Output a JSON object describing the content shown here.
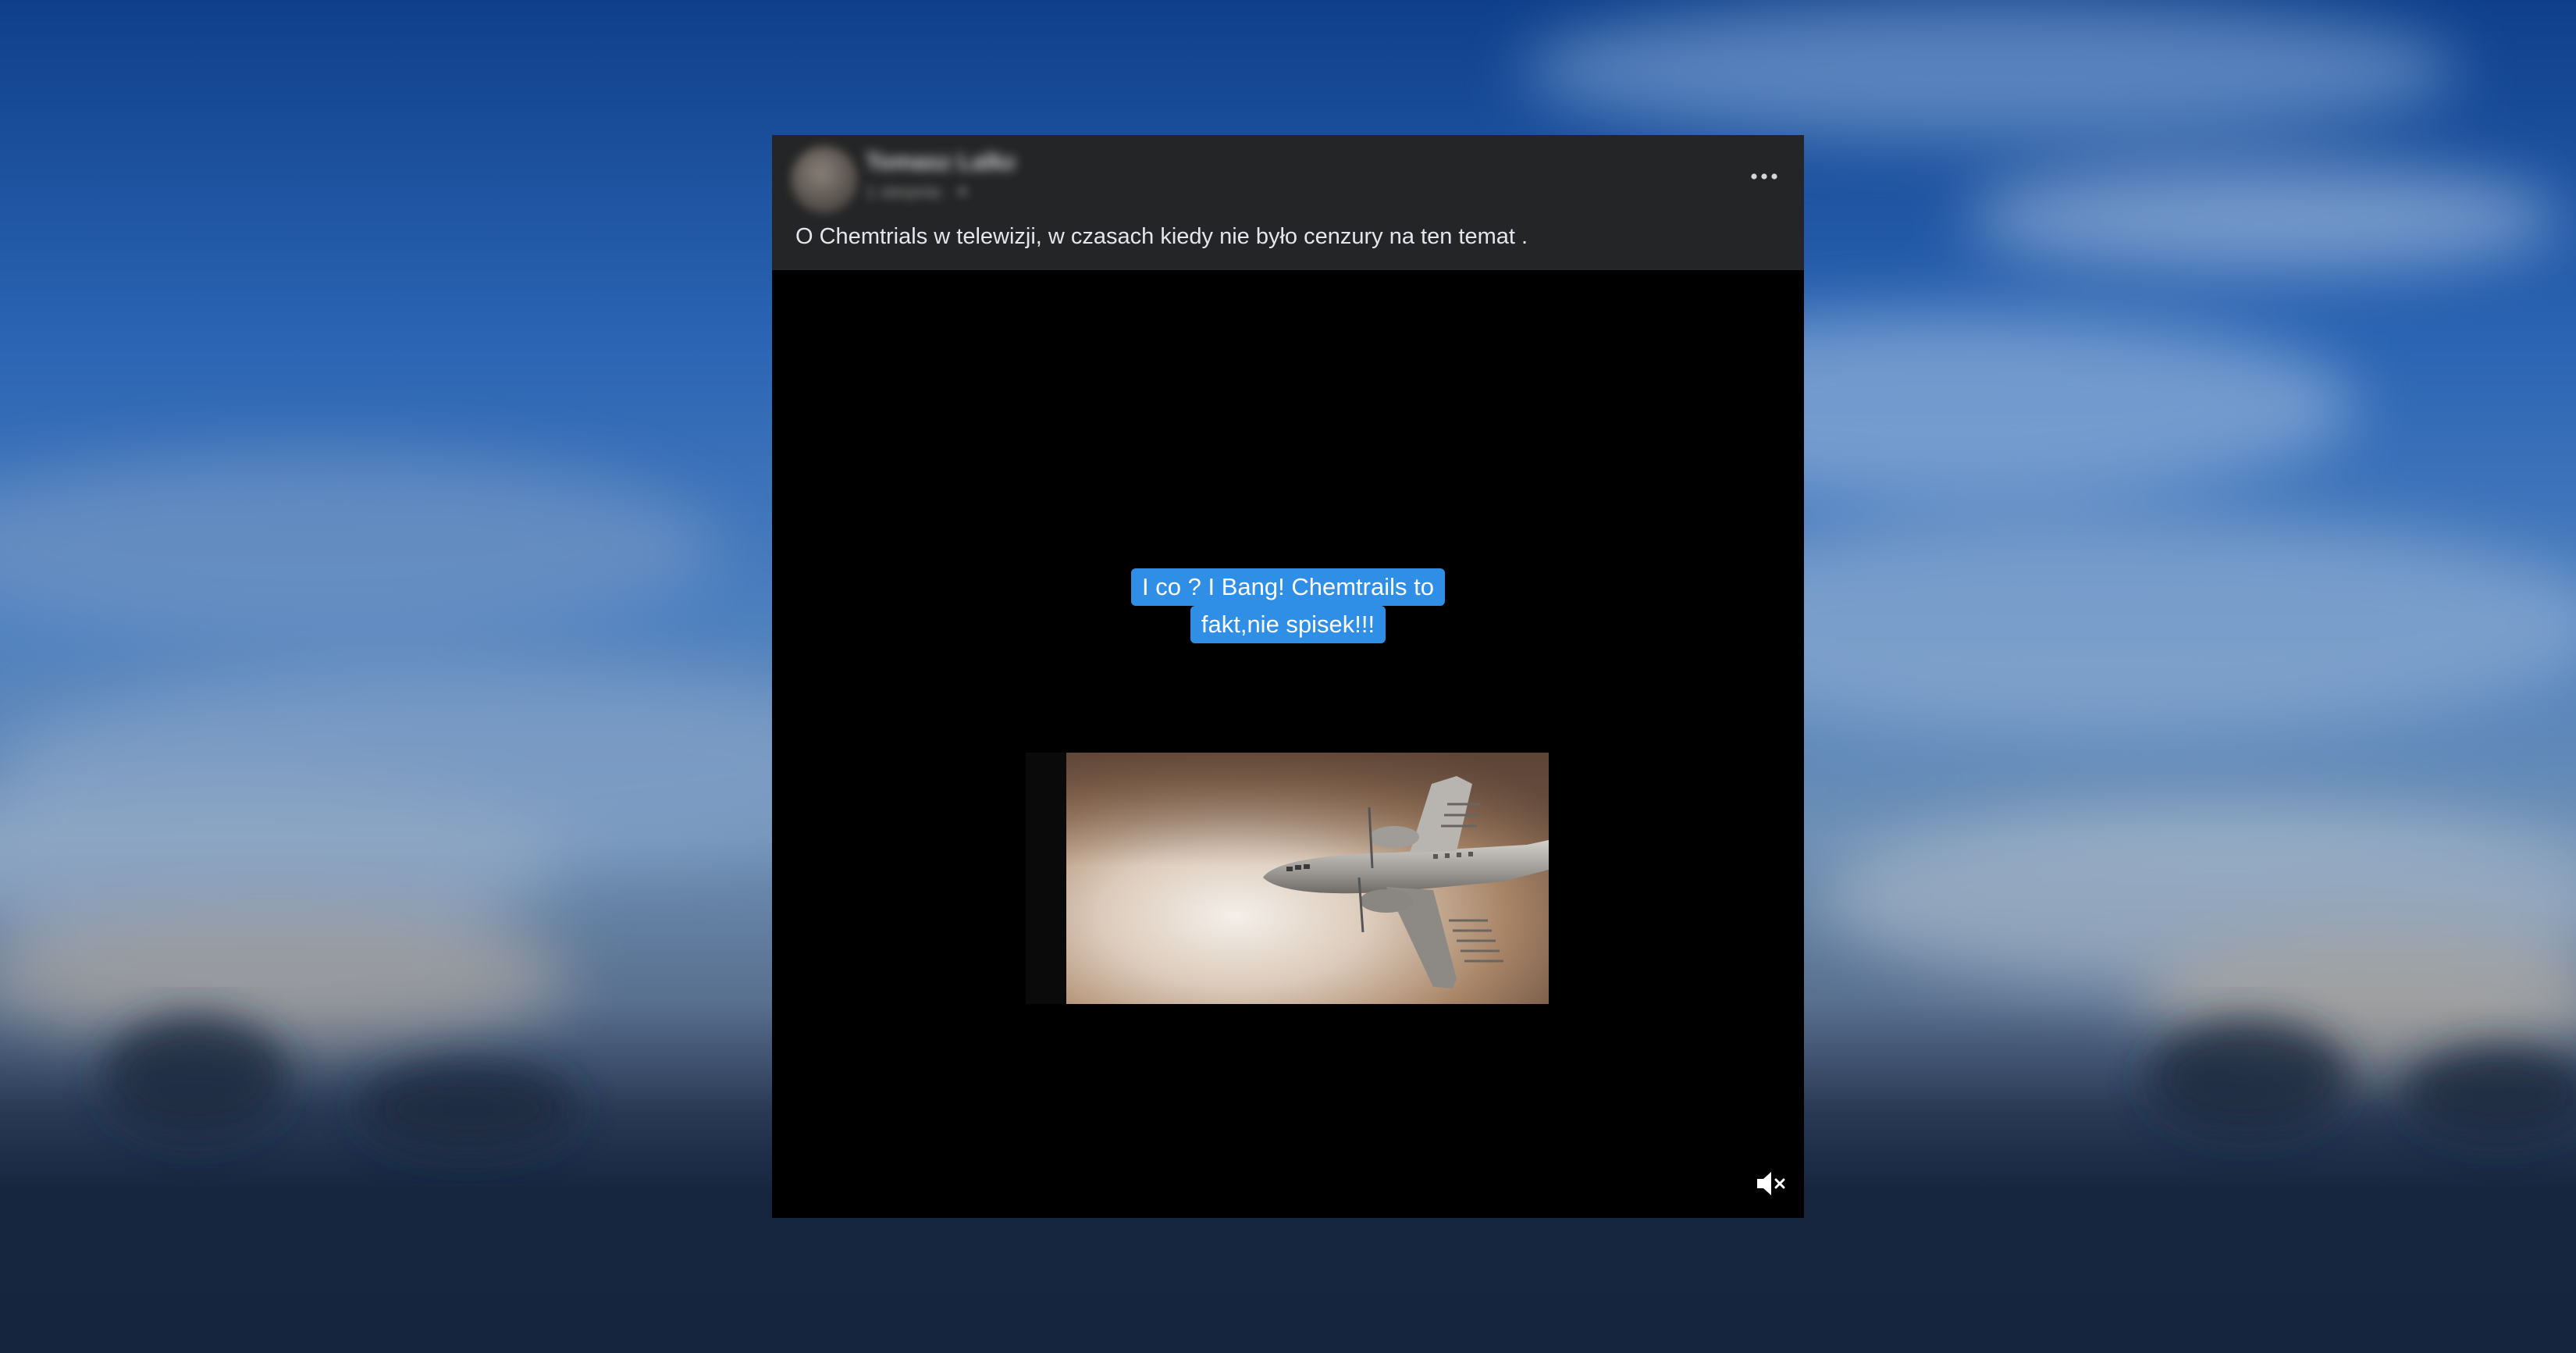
{
  "post": {
    "author_name": "Tomasz Lalka",
    "author_meta": "1 sierpnia · ✦",
    "caption": "O Chemtrials w telewizji, w czasach kiedy nie było cenzury na ten temat .",
    "more_icon": "more-horizontal-icon"
  },
  "video": {
    "overlay_line1": "I co ? I Bang! Chemtrails to",
    "overlay_line2": "fakt,nie spisek!!!",
    "overlay_color": "#2f8fe6",
    "mute_icon": "speaker-muted-icon"
  },
  "colors": {
    "header_bg": "#242526",
    "caption_text": "#e4e6eb",
    "video_bg": "#000000"
  }
}
